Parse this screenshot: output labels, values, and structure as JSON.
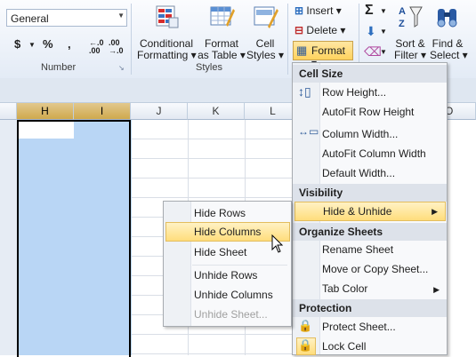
{
  "ribbon": {
    "number_group": {
      "format_value": "General",
      "currency": "$",
      "percent": "%",
      "comma": ",",
      "inc_decimal": "←.0 .00",
      "dec_decimal": ".00 →.0",
      "label": "Number"
    },
    "styles_group": {
      "conditional_formatting": [
        "Conditional",
        "Formatting ▾"
      ],
      "format_as_table": [
        "Format",
        "as Table ▾"
      ],
      "cell_styles": [
        "Cell",
        "Styles ▾"
      ],
      "label": "Styles"
    },
    "cells_group": {
      "insert": "Insert ▾",
      "delete": "Delete ▾",
      "format": "Format ▾"
    },
    "editing_group": {
      "sort_filter": [
        "Sort &",
        "Filter ▾"
      ],
      "find_select": [
        "Find &",
        "Select ▾"
      ]
    }
  },
  "sheet": {
    "columns": [
      "H",
      "I",
      "J",
      "K",
      "L"
    ],
    "partial_column": "O"
  },
  "format_menu": {
    "sections": {
      "cell_size": "Cell Size",
      "visibility": "Visibility",
      "organize": "Organize Sheets",
      "protection": "Protection"
    },
    "items": {
      "row_height": "Row Height...",
      "autofit_row": "AutoFit Row Height",
      "column_width": "Column Width...",
      "autofit_column": "AutoFit Column Width",
      "default_width": "Default Width...",
      "hide_unhide": "Hide & Unhide",
      "rename_sheet": "Rename Sheet",
      "move_copy": "Move or Copy Sheet...",
      "tab_color": "Tab Color",
      "protect_sheet": "Protect Sheet...",
      "lock_cell": "Lock Cell"
    }
  },
  "hide_submenu": {
    "hide_rows": "Hide Rows",
    "hide_columns": "Hide Columns",
    "hide_sheet": "Hide Sheet",
    "unhide_rows": "Unhide Rows",
    "unhide_columns": "Unhide Columns",
    "unhide_sheet": "Unhide Sheet..."
  },
  "colors": {
    "highlight": "#ffdd7c",
    "selection": "#b9d6f5",
    "ribbon": "#e3ebf6"
  }
}
